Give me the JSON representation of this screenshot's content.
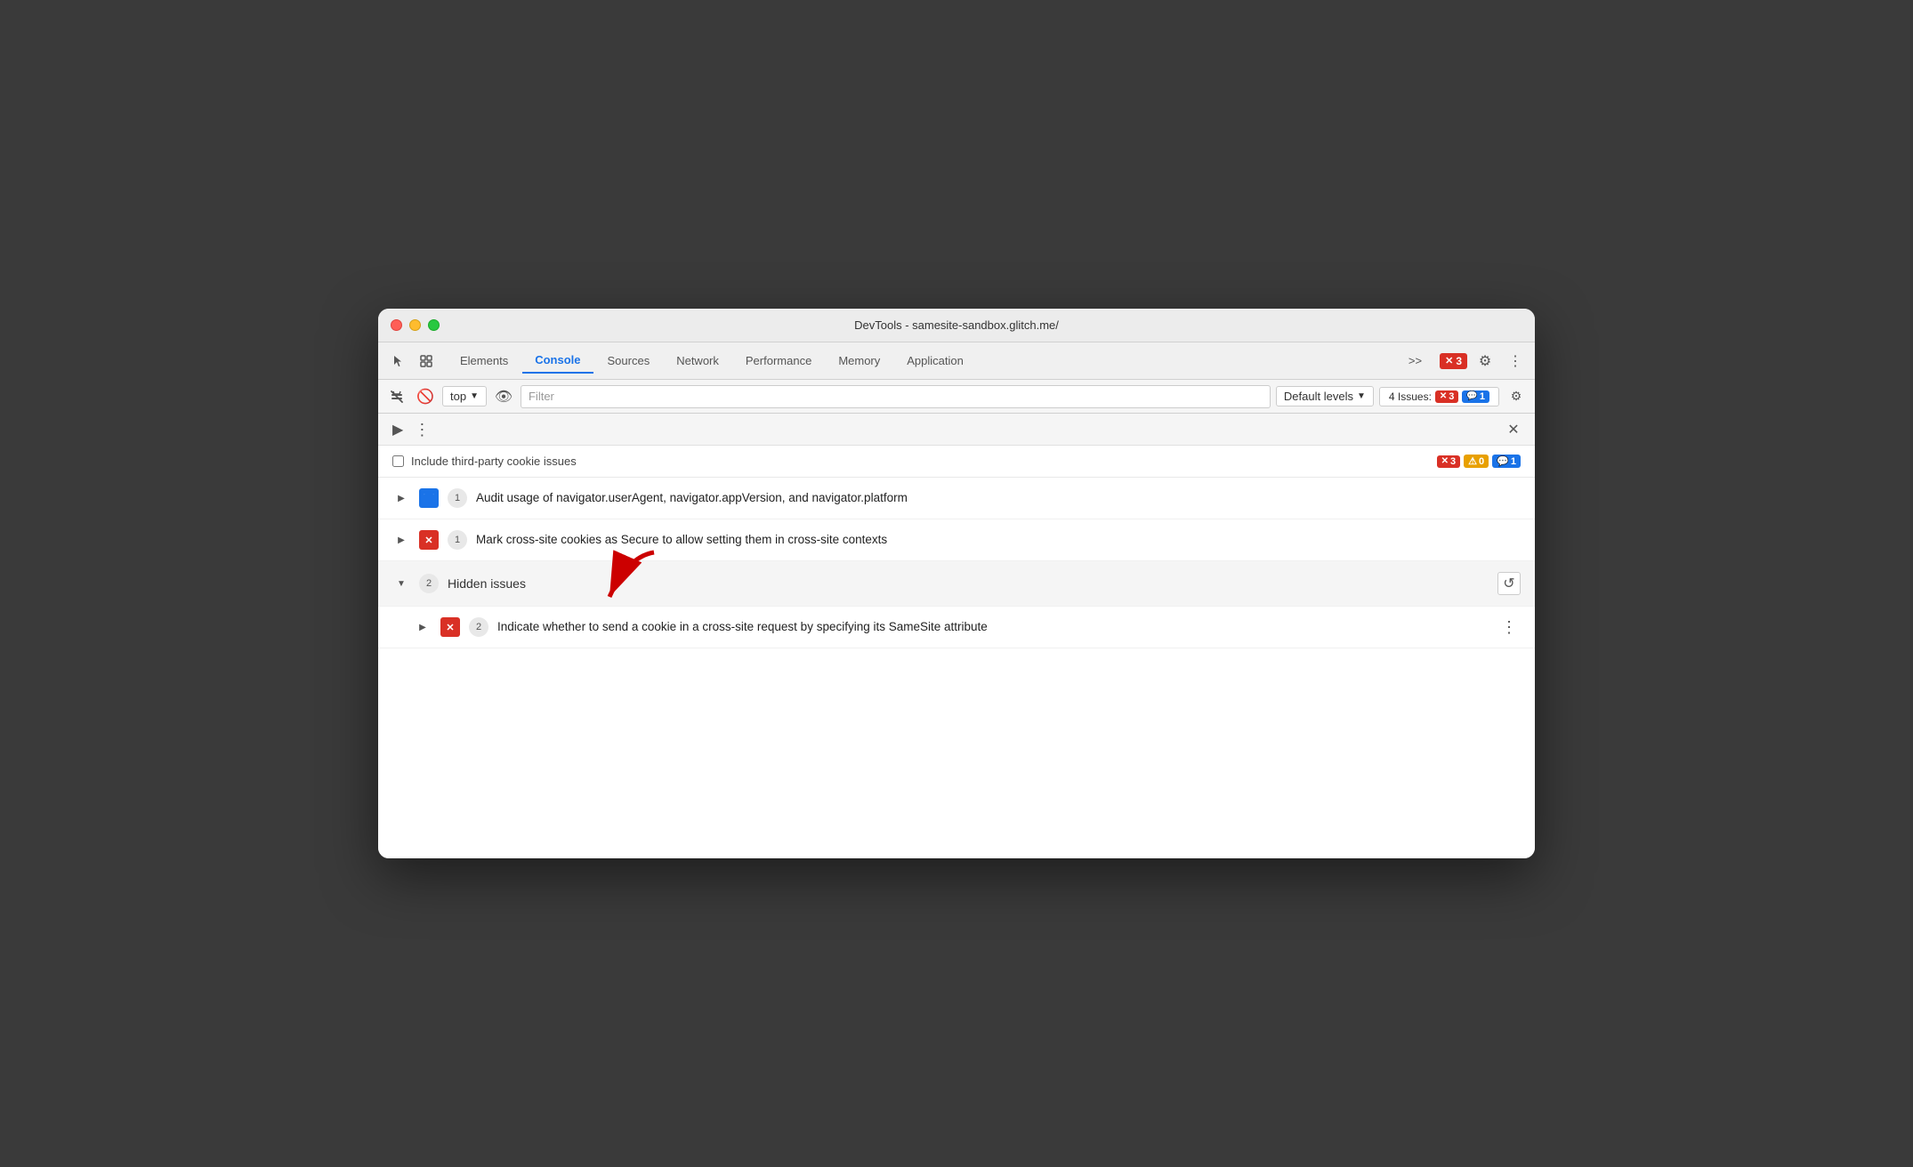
{
  "window": {
    "title": "DevTools - samesite-sandbox.glitch.me/"
  },
  "tabs": {
    "items": [
      {
        "id": "elements",
        "label": "Elements",
        "active": false
      },
      {
        "id": "console",
        "label": "Console",
        "active": true
      },
      {
        "id": "sources",
        "label": "Sources",
        "active": false
      },
      {
        "id": "network",
        "label": "Network",
        "active": false
      },
      {
        "id": "performance",
        "label": "Performance",
        "active": false
      },
      {
        "id": "memory",
        "label": "Memory",
        "active": false
      },
      {
        "id": "application",
        "label": "Application",
        "active": false
      }
    ],
    "more_label": ">>",
    "error_count": "3",
    "settings_label": "⚙",
    "more_dots_label": "⋮"
  },
  "toolbar": {
    "play_label": "▶",
    "block_label": "🚫",
    "context_label": "top",
    "eye_label": "👁",
    "filter_placeholder": "Filter",
    "levels_label": "Default levels",
    "issues_label": "4 Issues:",
    "issues_error_count": "3",
    "issues_info_count": "1",
    "settings_label": "⚙"
  },
  "console_panel": {
    "more_dots": "⋮",
    "close_label": "✕"
  },
  "issues_header": {
    "checkbox_label": "Include third-party cookie issues",
    "badge_red_count": "3",
    "badge_orange_count": "0",
    "badge_blue_count": "1"
  },
  "issues": [
    {
      "id": "issue-1",
      "arrow": "▶",
      "icon_type": "blue-msg",
      "icon_label": "💬",
      "count": "1",
      "text": "Audit usage of navigator.userAgent, navigator.appVersion, and navigator.platform",
      "hidden": false,
      "nested": false
    },
    {
      "id": "issue-2",
      "arrow": "▶",
      "icon_type": "red-x",
      "icon_label": "✕",
      "count": "1",
      "text": "Mark cross-site cookies as Secure to allow setting them in cross-site contexts",
      "hidden": false,
      "nested": false
    }
  ],
  "hidden_section": {
    "arrow": "▼",
    "count": "2",
    "title": "Hidden issues",
    "reload_label": "↺"
  },
  "nested_issue": {
    "arrow": "▶",
    "icon_type": "red-x",
    "icon_label": "✕",
    "count": "2",
    "text": "Indicate whether to send a cookie in a cross-site request by specifying its SameSite attribute",
    "more_dots": "⋮"
  }
}
